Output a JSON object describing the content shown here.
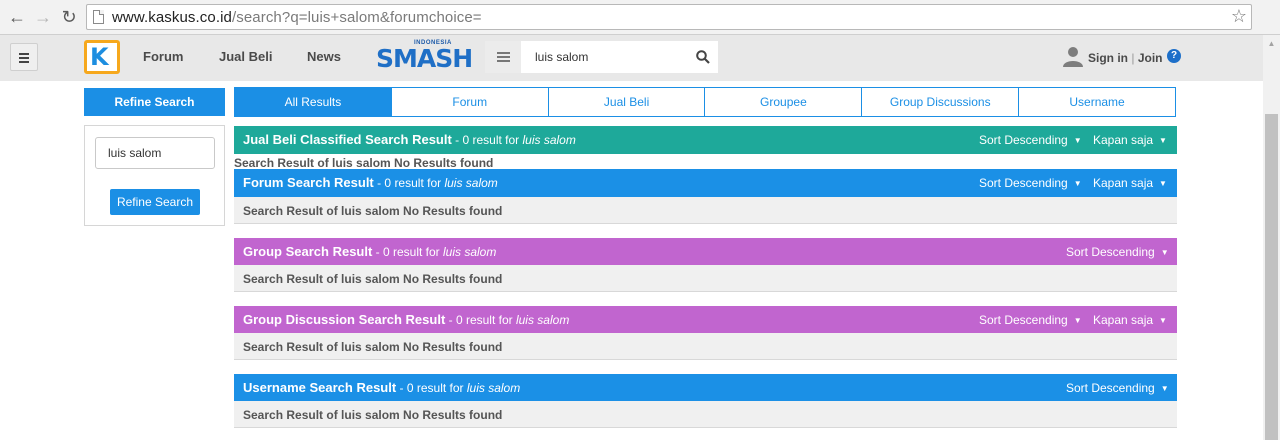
{
  "browser": {
    "url_host": "www.kaskus.co.id",
    "url_rest": "/search?q=luis+salom&forumchoice="
  },
  "header": {
    "nav": [
      "Forum",
      "Jual Beli",
      "News"
    ],
    "smash_small": "INDONESIA",
    "smash_big": "SMASH",
    "search_value": "luis salom",
    "signin": "Sign in",
    "sep": "|",
    "join": "Join",
    "help": "?"
  },
  "sidebar": {
    "header": "Refine Search",
    "input_value": "luis salom",
    "button": "Refine Search"
  },
  "tabs": [
    "All Results",
    "Forum",
    "Jual Beli",
    "Groupee",
    "Group Discussions",
    "Username"
  ],
  "sections": [
    {
      "title": "Jual Beli Classified Search Result",
      "count": " - 0 result for ",
      "query": "luis salom",
      "sort": "Sort Descending",
      "time": "Kapan saja",
      "body": "Search Result of luis salom No Results found",
      "color": "#1ea99a"
    },
    {
      "title": "Forum Search Result",
      "count": " - 0 result for ",
      "query": "luis salom",
      "sort": "Sort Descending",
      "time": "Kapan saja",
      "body": "Search Result of luis salom No Results found",
      "color": "#1b90e6"
    },
    {
      "title": "Group Search Result",
      "count": " - 0 result for ",
      "query": "luis salom",
      "sort": "Sort Descending",
      "body": "Search Result of luis salom No Results found",
      "color": "#c165cf"
    },
    {
      "title": "Group Discussion Search Result",
      "count": " - 0 result for ",
      "query": "luis salom",
      "sort": "Sort Descending",
      "time": "Kapan saja",
      "body": "Search Result of luis salom No Results found",
      "color": "#c165cf"
    },
    {
      "title": "Username Search Result",
      "count": " - 0 result for ",
      "query": "luis salom",
      "sort": "Sort Descending",
      "body": "Search Result of luis salom No Results found",
      "color": "#1b90e6"
    }
  ],
  "caret": "▼"
}
